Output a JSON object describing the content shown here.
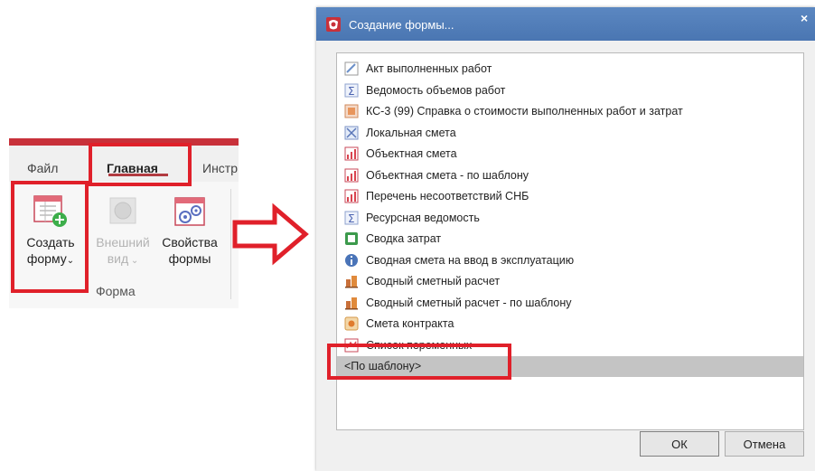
{
  "ribbon": {
    "tabs": {
      "file": "Файл",
      "main": "Главная",
      "instr": "Инстр"
    },
    "buttons": {
      "create_line1": "Создать",
      "create_line2": "форму",
      "view_line1": "Внешний",
      "view_line2": "вид",
      "props_line1": "Свойства",
      "props_line2": "формы"
    },
    "group_label": "Форма",
    "accent_color": "#c8313a"
  },
  "dialog": {
    "title": "Создание формы...",
    "close": "×",
    "items": [
      {
        "label": "Акт выполненных работ",
        "icon": "act-icon"
      },
      {
        "label": "Ведомость объемов работ",
        "icon": "sigma-icon"
      },
      {
        "label": "КС-3 (99) Справка о стоимости выполненных работ и затрат",
        "icon": "ks3-icon"
      },
      {
        "label": "Локальная смета",
        "icon": "local-estimate-icon"
      },
      {
        "label": "Объектная смета",
        "icon": "object-estimate-icon"
      },
      {
        "label": "Объектная смета - по шаблону",
        "icon": "object-estimate-icon"
      },
      {
        "label": "Перечень несоответствий СНБ",
        "icon": "object-estimate-icon"
      },
      {
        "label": "Ресурсная ведомость",
        "icon": "sigma-icon"
      },
      {
        "label": "Сводка затрат",
        "icon": "summary-icon"
      },
      {
        "label": "Сводная смета на ввод в эксплуатацию",
        "icon": "info-icon"
      },
      {
        "label": "Сводный сметный расчет",
        "icon": "building-icon"
      },
      {
        "label": "Сводный сметный расчет - по шаблону",
        "icon": "building-icon"
      },
      {
        "label": "Смета контракта",
        "icon": "contract-icon"
      },
      {
        "label": "Список переменных",
        "icon": "variables-icon"
      }
    ],
    "template_item": "<По шаблону>",
    "ok_label": "ОК",
    "cancel_label": "Отмена"
  },
  "colors": {
    "highlight": "#e0202a",
    "titlebar": "#4a76b2",
    "selection": "#c4c4c4"
  }
}
